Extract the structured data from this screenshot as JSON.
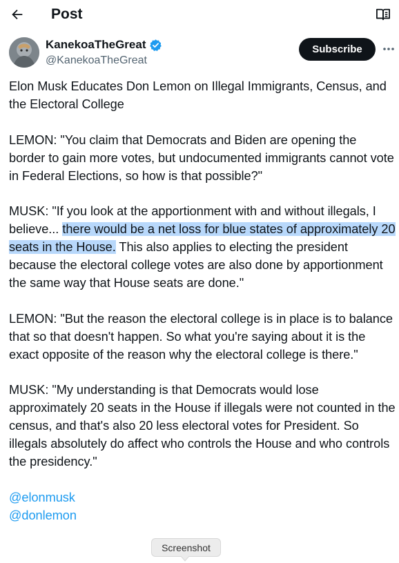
{
  "header": {
    "title": "Post"
  },
  "author": {
    "display_name": "KanekoaTheGreat",
    "handle": "@KanekoaTheGreat",
    "subscribe_label": "Subscribe"
  },
  "post": {
    "title_line": "Elon Musk Educates Don Lemon on Illegal Immigrants, Census, and the Electoral College",
    "p1": "LEMON: \"You claim that Democrats and Biden are opening the border to gain more votes, but undocumented immigrants cannot vote in Federal Elections, so how is that possible?\"",
    "p2_before": "MUSK: \"If you look at the apportionment with and without illegals, I believe... ",
    "p2_highlight": "there would be a net loss for blue states of approximately 20 seats in the House.",
    "p2_after": " This also applies to electing the president because the electoral college votes are also done by apportionment the same way that House seats are done.\"",
    "p3": "LEMON: \"But the reason the electoral college is in place is to balance that so that doesn't happen. So what you're saying about it is the exact opposite of the reason why the electoral college is there.\"",
    "p4": "MUSK: \"My understanding is that Democrats would lose approximately 20 seats in the House if illegals were not counted in the census, and that's also 20 less electoral votes for President. So illegals absolutely do affect who controls the House and who controls the presidency.\"",
    "mentions": [
      "@elonmusk",
      "@donlemon"
    ]
  },
  "tooltip": {
    "label": "Screenshot"
  },
  "colors": {
    "link": "#1d9bf0",
    "highlight": "#b8d8fb",
    "button_dark": "#0f1419",
    "secondary_text": "#536471"
  },
  "icons": {
    "back": "arrow-left-icon",
    "reader": "open-book-icon",
    "verified": "verified-badge-icon",
    "more": "more-dots-icon"
  }
}
